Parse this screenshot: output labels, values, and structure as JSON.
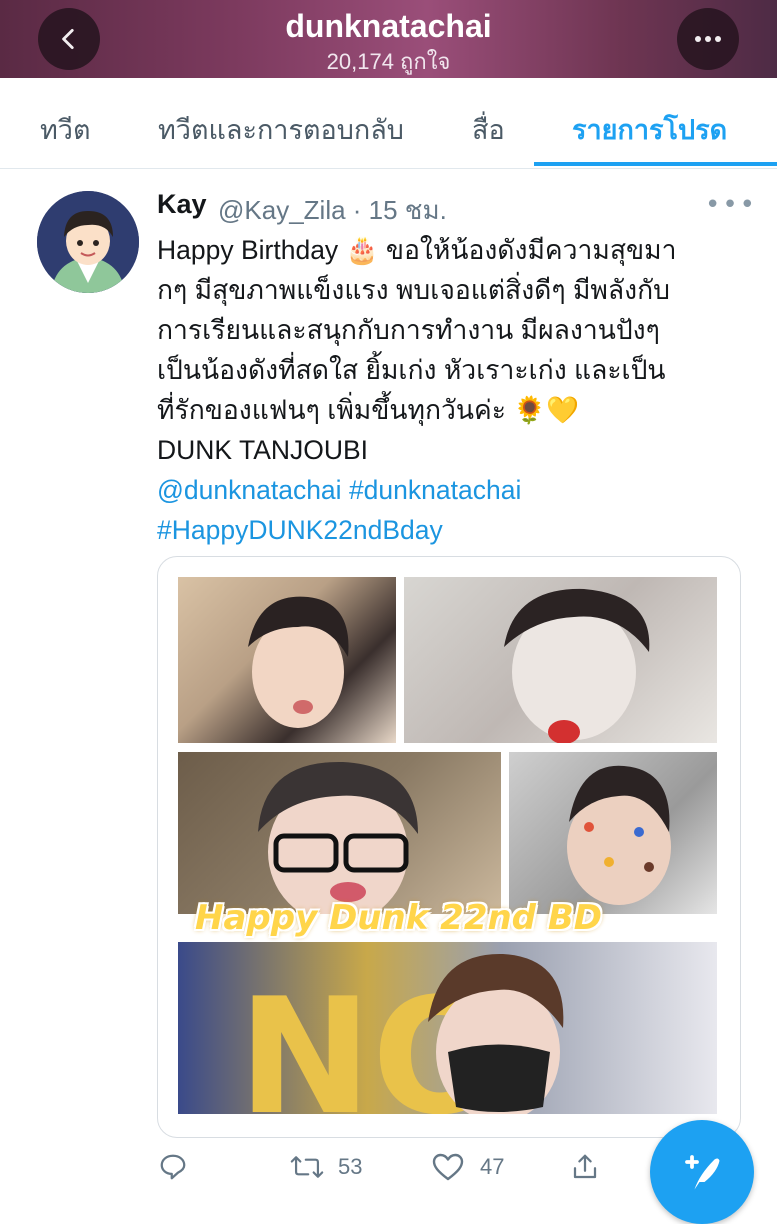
{
  "header": {
    "title": "dunknatachai",
    "subtitle": "20,174 ถูกใจ",
    "back_icon": "chevron-left-icon",
    "more_icon": "more-horizontal-icon"
  },
  "tabs": [
    {
      "label": "ทวีต",
      "active": false
    },
    {
      "label": "ทวีตและการตอบกลับ",
      "active": false
    },
    {
      "label": "สื่อ",
      "active": false
    },
    {
      "label": "รายการโปรด",
      "active": true
    }
  ],
  "tweet": {
    "name": "Kay",
    "handle": "@Kay_Zila · 15 ชม.",
    "text_lines": [
      "Happy Birthday 🎂 ขอให้น้องดังมีความสุขมา",
      "กๆ มีสุขภาพแข็งแรง พบเจอแต่สิ่งดีๆ มีพลังกับ",
      "การเรียนและสนุกกับการทำงาน มีผลงานปังๆ",
      "เป็นน้องดังที่สดใส ยิ้มเก่ง หัวเราะเก่ง และเป็น",
      "ที่รักของแฟนๆ เพิ่มขึ้นทุกวันค่ะ 🌻💛",
      "DUNK TANJOUBI"
    ],
    "mention": "@dunknatachai",
    "hashtag1": "#dunknatachai",
    "hashtag2": "#HappyDUNK22ndBday",
    "media_banner": "Happy Dunk 22nd BD",
    "actions": {
      "reply_icon": "reply-icon",
      "retweet_icon": "retweet-icon",
      "retweet_count": "53",
      "like_icon": "heart-icon",
      "like_count": "47",
      "share_icon": "share-icon"
    }
  },
  "compose_icon": "compose-tweet-icon",
  "colors": {
    "accent": "#1da1f2",
    "link": "#1b95e0",
    "header_bg": "#7c3a5e",
    "muted": "#657786"
  }
}
